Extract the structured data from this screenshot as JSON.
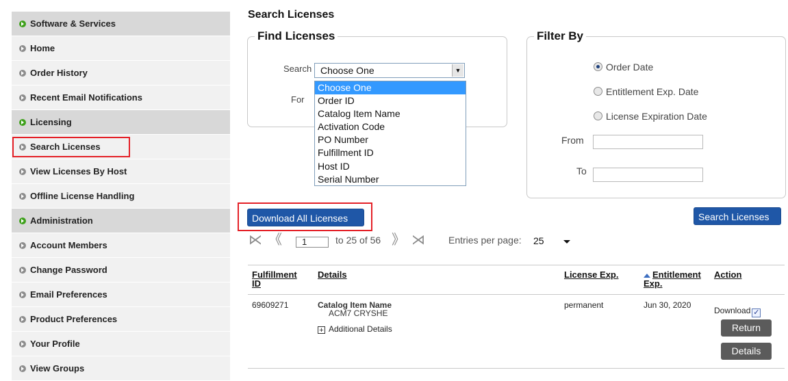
{
  "sidebar": {
    "items": [
      {
        "label": "Software & Services",
        "type": "section"
      },
      {
        "label": "Home",
        "type": "item"
      },
      {
        "label": "Order History",
        "type": "item"
      },
      {
        "label": "Recent Email Notifications",
        "type": "item"
      },
      {
        "label": "Licensing",
        "type": "section"
      },
      {
        "label": "Search Licenses",
        "type": "item",
        "selected": true
      },
      {
        "label": "View Licenses By Host",
        "type": "item"
      },
      {
        "label": "Offline License Handling",
        "type": "item"
      },
      {
        "label": "Administration",
        "type": "section"
      },
      {
        "label": "Account Members",
        "type": "item"
      },
      {
        "label": "Change Password",
        "type": "item"
      },
      {
        "label": "Email Preferences",
        "type": "item"
      },
      {
        "label": "Product Preferences",
        "type": "item"
      },
      {
        "label": "Your Profile",
        "type": "item"
      },
      {
        "label": "View Groups",
        "type": "item"
      }
    ]
  },
  "main": {
    "title": "Search Licenses",
    "find": {
      "legend": "Find Licenses",
      "search_label": "Search",
      "for_label": "For",
      "selected": "Choose One",
      "options": [
        "Choose One",
        "Order ID",
        "Catalog Item Name",
        "Activation Code",
        "PO Number",
        "Fulfillment ID",
        "Host ID",
        "Serial Number"
      ]
    },
    "filter": {
      "legend": "Filter By",
      "radios": [
        "Order Date",
        "Entitlement Exp. Date",
        "License Expiration Date"
      ],
      "from_label": "From",
      "to_label": "To"
    },
    "download_all": "Download All Licenses",
    "search_button": "Search Licenses",
    "pager": {
      "page": "1",
      "range_text": "to 25 of 56",
      "entries_label": "Entries per page:",
      "entries_value": "25"
    },
    "table": {
      "headers": {
        "fulfillment_id": "Fulfillment ID",
        "details": "Details",
        "license_exp": "License Exp.",
        "entitlement_exp": "Entitlement Exp.",
        "action": "Action"
      },
      "rows": [
        {
          "fulfillment_id": "69609271",
          "details_label": "Catalog Item Name",
          "details_value": "ACM7 CRYSHE",
          "additional": "Additional Details",
          "license_exp": "permanent",
          "entitlement_exp": "Jun 30, 2020",
          "download_label": "Download",
          "return_label": "Return",
          "details_button": "Details"
        }
      ]
    }
  },
  "colors": {
    "accent_blue": "#1f57a7",
    "highlight_red": "#e41f26",
    "section_green": "#3fa11c"
  }
}
